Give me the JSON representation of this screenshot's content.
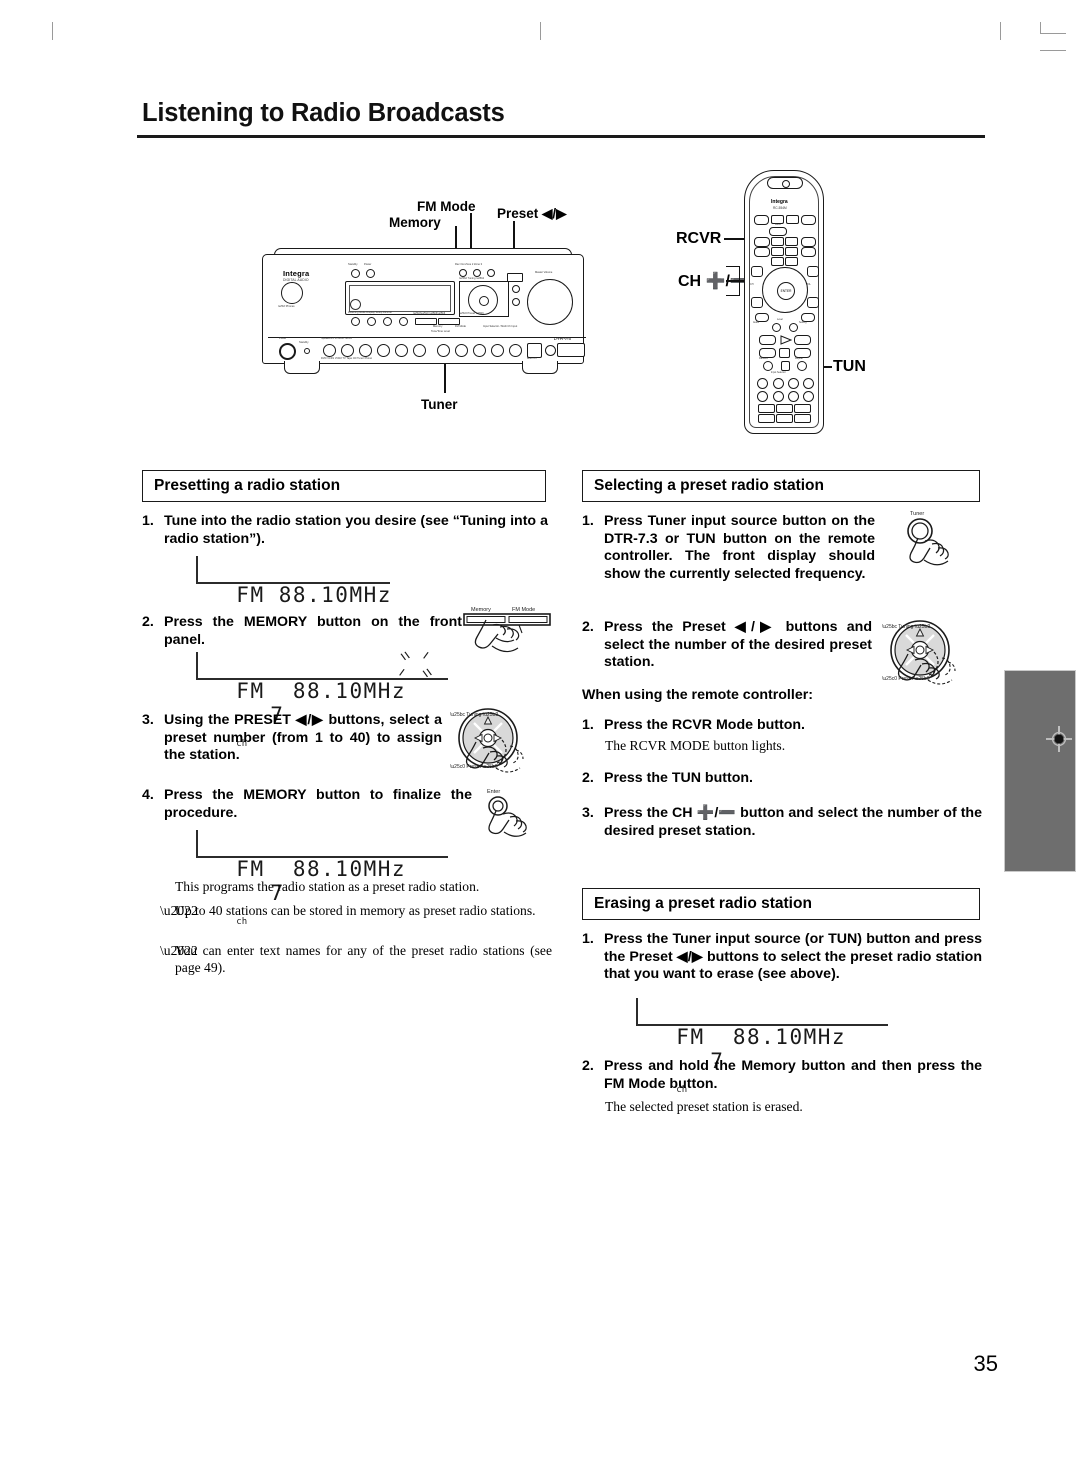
{
  "page": {
    "title": "Listening to Radio Broadcasts",
    "number": "35"
  },
  "diagram": {
    "callouts": {
      "fm_mode": "FM Mode",
      "memory": "Memory",
      "preset": "Preset ◀/▶",
      "tuner": "Tuner",
      "rcvr": "RCVR",
      "ch": "CH ➕/➖",
      "tun": "TUN"
    },
    "receiver": {
      "brand": "Integra",
      "brand_sub": "DIGITAL AUDIO",
      "model": "DTR-7.3",
      "knob_labels": [
        "Phones",
        "Standby",
        "Power",
        "Speakers A",
        "Speakers B",
        "Master Volume"
      ],
      "source_labels": [
        "DVD",
        "VCR1",
        "VCR2",
        "TV",
        "Tape",
        "CD",
        "Tuner",
        "Phono",
        "Multi Ch"
      ],
      "display_labels": [
        "Listening Mode",
        "Memory",
        "FM Mode",
        "Display",
        "Setup",
        "Enter",
        "Tuning",
        "Preset"
      ]
    },
    "remote": {
      "brand": "Integra",
      "model": "RC-554M",
      "center_key": "ENTER",
      "section_label": "Input Selector"
    }
  },
  "sections": {
    "presetting": {
      "heading": "Presetting a radio station",
      "steps": [
        {
          "num": "1.",
          "text": "Tune into the radio station you desire (see “Tuning into a radio station”)."
        },
        {
          "num": "2.",
          "text": "Press the MEMORY button on the front panel."
        },
        {
          "num": "3.",
          "text": "Using the PRESET ◀/▶ buttons, select a preset number (from 1 to 40) to assign the station."
        },
        {
          "num": "4.",
          "text": "Press the MEMORY button to finalize the procedure."
        }
      ],
      "after_note": "This programs the radio station as a preset radio station.",
      "bullets": [
        "Up to 40 stations can be stored in memory as preset radio stations.",
        "You can enter text names for any of the preset radio stations (see page 49)."
      ],
      "displays": [
        {
          "id": "display-1",
          "text": "FM 88.10MHz",
          "preset": "",
          "blinking": false
        },
        {
          "id": "display-2",
          "text": "FM  88.10MHz",
          "preset": "7",
          "unit": "ch",
          "blinking": true
        },
        {
          "id": "display-3",
          "text": "FM  88.10MHz",
          "preset": "7",
          "unit": "ch",
          "blinking": false
        }
      ]
    },
    "selecting": {
      "heading": "Selecting a preset radio station",
      "steps": [
        {
          "num": "1.",
          "text": "Press Tuner input source button on the DTR-7.3 or TUN button on the remote controller. The front display should show the currently selected frequency."
        },
        {
          "num": "2.",
          "text": "Press the Preset ◀/▶ buttons and select the number of the desired preset station."
        }
      ],
      "remote_heading": "When using the remote controller:",
      "remote_steps": [
        {
          "num": "1.",
          "text": "Press the RCVR Mode button.",
          "note": "The RCVR MODE button lights."
        },
        {
          "num": "2.",
          "text": "Press the TUN button.",
          "note": ""
        },
        {
          "num": "3.",
          "text": "Press the CH ➕/➖ button and select the number of the desired preset station.",
          "note": ""
        }
      ]
    },
    "erasing": {
      "heading": "Erasing a preset radio station",
      "steps": [
        {
          "num": "1.",
          "text": "Press the Tuner input source (or TUN) button and press the Preset ◀/▶ buttons to select the preset radio station that you want to erase (see above)."
        },
        {
          "num": "2.",
          "text": "Press and hold the Memory button and then press the FM Mode button."
        }
      ],
      "after_note": "The selected preset station is erased.",
      "display": {
        "id": "display-4",
        "text": "FM  88.10MHz",
        "preset": "7",
        "unit": "ch"
      }
    }
  },
  "illustrations": {
    "memory_fm": {
      "label_left": "Memory",
      "label_right": "FM Mode"
    },
    "dpad": {
      "label_tuning": "Tuning",
      "label_preset": "Preset"
    },
    "enter": {
      "label": "Enter"
    },
    "tuner_knob": {
      "label": "Tuner"
    }
  },
  "colors": {
    "ink": "#1a1a1a",
    "rule": "#1a1a1a",
    "reg_bar": "#6e6e6e",
    "crop_mark": "#9a9a9a"
  }
}
